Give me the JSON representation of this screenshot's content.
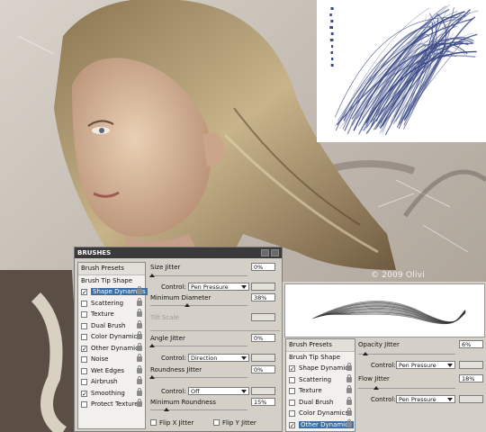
{
  "copyright": "© 2009 Olivi",
  "brushes_panel": {
    "title": "BRUSHES",
    "list": [
      {
        "label": "Brush Presets",
        "type": "header",
        "checked": false
      },
      {
        "label": "Brush Tip Shape",
        "type": "plain",
        "checked": false
      },
      {
        "label": "Shape Dynamics",
        "type": "item",
        "checked": true,
        "selected": true
      },
      {
        "label": "Scattering",
        "type": "item",
        "checked": false
      },
      {
        "label": "Texture",
        "type": "item",
        "checked": false
      },
      {
        "label": "Dual Brush",
        "type": "item",
        "checked": false
      },
      {
        "label": "Color Dynamics",
        "type": "item",
        "checked": false
      },
      {
        "label": "Other Dynamics",
        "type": "item",
        "checked": true
      },
      {
        "label": "Noise",
        "type": "item",
        "checked": false
      },
      {
        "label": "Wet Edges",
        "type": "item",
        "checked": false
      },
      {
        "label": "Airbrush",
        "type": "item",
        "checked": false
      },
      {
        "label": "Smoothing",
        "type": "item",
        "checked": true
      },
      {
        "label": "Protect Texture",
        "type": "item",
        "checked": false
      }
    ],
    "size_jitter_label": "Size Jitter",
    "size_jitter_value": "0%",
    "size_control_label": "Control:",
    "size_control_value": "Pen Pressure",
    "min_diameter_label": "Minimum Diameter",
    "min_diameter_value": "38%",
    "tilt_scale_label": "Tilt Scale",
    "angle_jitter_label": "Angle Jitter",
    "angle_jitter_value": "0%",
    "angle_control_label": "Control:",
    "angle_control_value": "Direction",
    "roundness_jitter_label": "Roundness Jitter",
    "roundness_jitter_value": "0%",
    "roundness_control_label": "Control:",
    "roundness_control_value": "Off",
    "min_roundness_label": "Minimum Roundness",
    "min_roundness_value": "15%",
    "flip_x_label": "Flip X Jitter",
    "flip_y_label": "Flip Y Jitter"
  },
  "other_dynamics_panel": {
    "list": [
      {
        "label": "Brush Presets",
        "type": "header",
        "checked": false
      },
      {
        "label": "Brush Tip Shape",
        "type": "plain",
        "checked": false
      },
      {
        "label": "Shape Dynamics",
        "type": "item",
        "checked": true
      },
      {
        "label": "Scattering",
        "type": "item",
        "checked": false
      },
      {
        "label": "Texture",
        "type": "item",
        "checked": false
      },
      {
        "label": "Dual Brush",
        "type": "item",
        "checked": false
      },
      {
        "label": "Color Dynamics",
        "type": "item",
        "checked": false
      },
      {
        "label": "Other Dynamics",
        "type": "item",
        "checked": true,
        "selected": true
      }
    ],
    "opacity_jitter_label": "Opacity Jitter",
    "opacity_jitter_value": "6%",
    "opacity_control_label": "Control:",
    "opacity_control_value": "Pen Pressure",
    "flow_jitter_label": "Flow Jitter",
    "flow_jitter_value": "18%",
    "flow_control_label": "Control:",
    "flow_control_value": "Pen Pressure"
  },
  "colors": {
    "stroke_blue": "#3b4a86",
    "panel_bg": "#d4d0c8",
    "title_bg": "#3a3a3a",
    "selected_bg": "#3a6ea5"
  }
}
